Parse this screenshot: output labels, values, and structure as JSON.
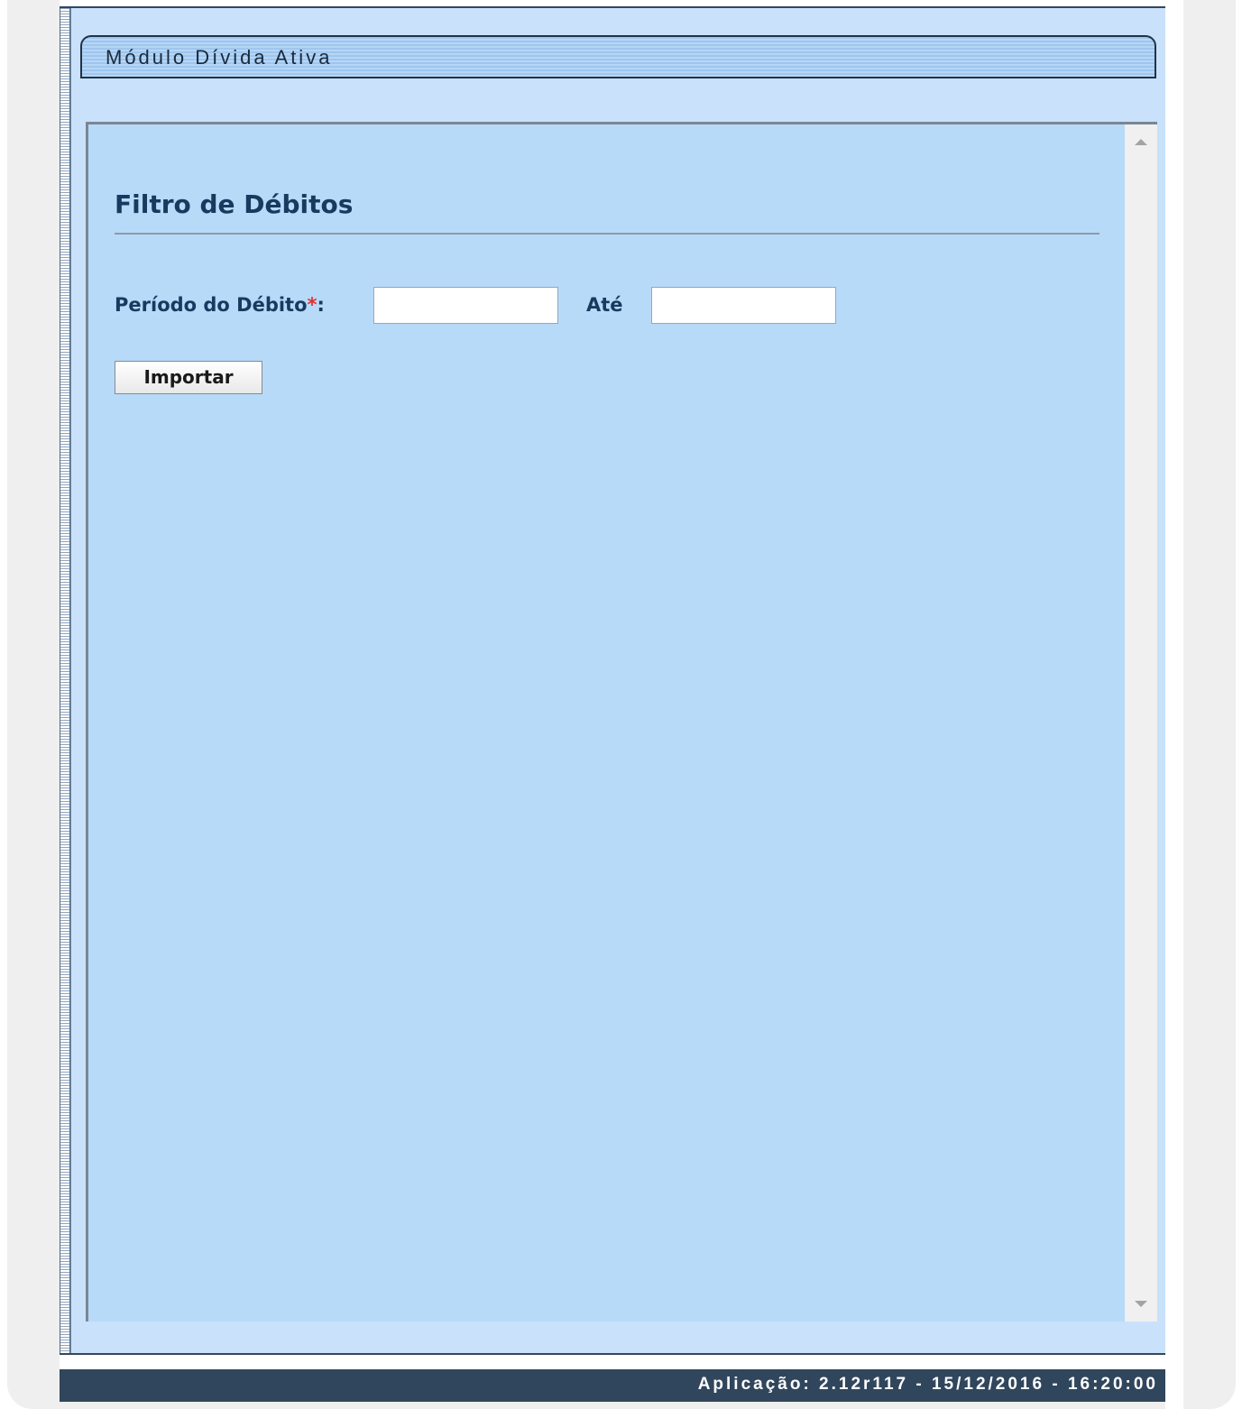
{
  "module": {
    "title": "Módulo Dívida Ativa"
  },
  "filter": {
    "section_title": "Filtro de Débitos",
    "period_label": "Período do Débito",
    "required_marker": "*",
    "label_suffix": ":",
    "until_label": "Até",
    "start_value": "",
    "end_value": "",
    "import_label": "Importar"
  },
  "footer": {
    "text": "Aplicação: 2.12r117 - 15/12/2016 - 16:20:00"
  },
  "icons": {
    "scroll_up": "scroll-up-arrow-icon",
    "scroll_down": "scroll-down-arrow-icon"
  },
  "colors": {
    "content_bg": "#c9e1fa",
    "panel_bg": "#b8daf9",
    "label_color": "#173a5e",
    "required_color": "#e53030",
    "footer_bg": "#30465c"
  }
}
